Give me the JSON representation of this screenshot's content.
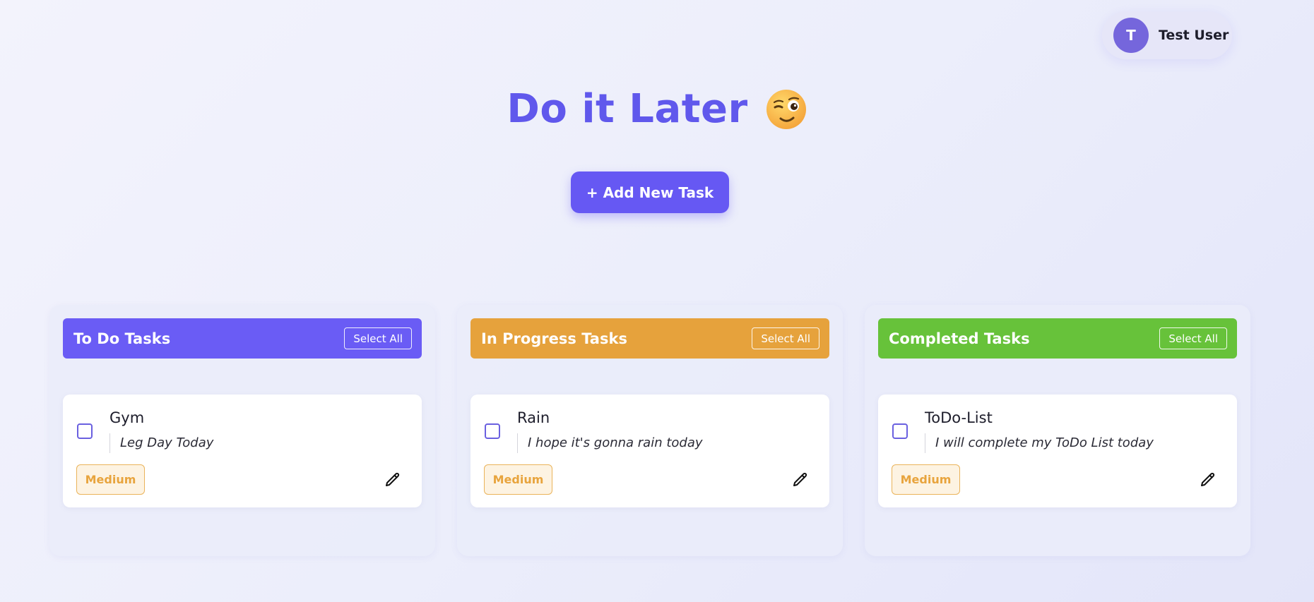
{
  "user": {
    "initial": "T",
    "name": "Test User"
  },
  "app": {
    "title": "Do it Later",
    "title_icon": "winking-face-icon"
  },
  "actions": {
    "add_task_label": "+ Add New Task"
  },
  "colors": {
    "accent": "#6658f3",
    "todo": "#6a5cf5",
    "in_progress": "#e6a23c",
    "completed": "#67c23a",
    "priority_medium": "#e8a43d"
  },
  "columns": [
    {
      "title": "To Do Tasks",
      "select_all_label": "Select All",
      "tasks": [
        {
          "name": "Gym",
          "description": "Leg Day Today",
          "priority": "Medium"
        }
      ]
    },
    {
      "title": "In Progress Tasks",
      "select_all_label": "Select All",
      "tasks": [
        {
          "name": "Rain",
          "description": "I hope it's gonna rain today",
          "priority": "Medium"
        }
      ]
    },
    {
      "title": "Completed Tasks",
      "select_all_label": "Select All",
      "tasks": [
        {
          "name": "ToDo-List",
          "description": "I will complete my ToDo List today",
          "priority": "Medium"
        }
      ]
    }
  ]
}
